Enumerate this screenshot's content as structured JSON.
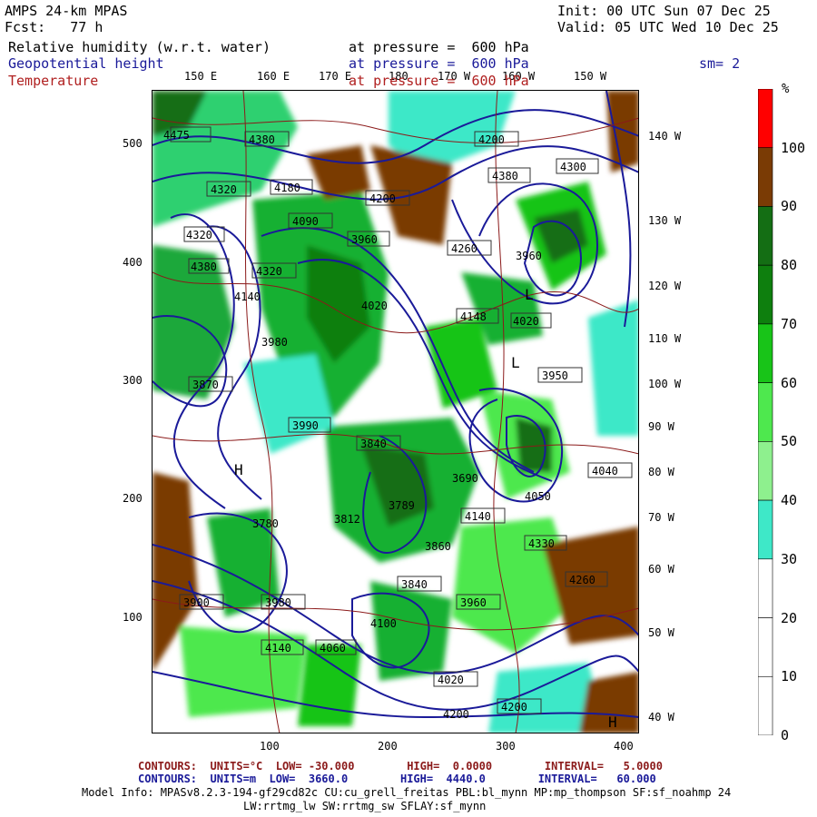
{
  "header": {
    "model_title": "AMPS 24-km MPAS",
    "init_label": "Init: 00 UTC Sun 07 Dec 25",
    "fcst_label": "Fcst:   77 h",
    "valid_label": "Valid: 05 UTC Wed 10 Dec 25"
  },
  "fields": [
    {
      "name": "Relative humidity (w.r.t. water)",
      "level": "at pressure =  600 hPa",
      "color": "#000000"
    },
    {
      "name": "Geopotential height",
      "level": "at pressure =  600 hPa",
      "color": "#1a1a99"
    },
    {
      "name": "Temperature",
      "level": "at pressure =  600 hPa",
      "color": "#b02020"
    }
  ],
  "smoothing": "sm= 2",
  "map": {
    "top_lon_labels": [
      "150 E",
      "160 E",
      "170 E",
      "180",
      "170 W",
      "160 W",
      "150 W"
    ],
    "right_lon_labels": [
      "140 W",
      "130 W",
      "120 W",
      "110 W",
      "100 W",
      "90 W",
      "80 W",
      "70 W",
      "60 W",
      "50 W",
      "40 W"
    ],
    "y_ticks": [
      "500",
      "400",
      "300",
      "200",
      "100"
    ],
    "x_ticks": [
      "100",
      "200",
      "300",
      "400"
    ],
    "height_labels": [
      "4475",
      "4380",
      "4320",
      "4320",
      "4200",
      "4380",
      "4300",
      "4200",
      "4180",
      "4090",
      "3960",
      "4380",
      "4320",
      "4260",
      "3980",
      "4140",
      "4148",
      "4020",
      "3960",
      "3870",
      "4020",
      "3950",
      "3990",
      "3840",
      "4050",
      "4140",
      "3780",
      "3812",
      "3789",
      "3860",
      "3690",
      "3840",
      "3960",
      "4100",
      "4060",
      "4140",
      "4020",
      "4200",
      "4200",
      "3900",
      "3980",
      "4260",
      "4040",
      "4330"
    ],
    "high_low_marks": [
      "H",
      "L",
      "L",
      "H"
    ]
  },
  "legend": {
    "unit": "%",
    "levels": [
      "100",
      "90",
      "80",
      "70",
      "60",
      "50",
      "40",
      "30",
      "20",
      "10",
      "0"
    ],
    "colors": [
      "#ff0000",
      "#7a3b05",
      "#146e14",
      "#0e7f0e",
      "#18c418",
      "#4ee84e",
      "#8ef08e",
      "#3ee8c8",
      "#ffffff",
      "#ffffff",
      "#ffffff"
    ]
  },
  "footer": {
    "temp_contours": "CONTOURS:  UNITS=°C  LOW= -30.000        HIGH=  0.0000        INTERVAL=   5.0000",
    "height_contours": "CONTOURS:  UNITS=m  LOW=  3660.0        HIGH=  4440.0        INTERVAL=   60.000",
    "model_info_1": "Model Info: MPASv8.2.3-194-gf29cd82c CU:cu_grell_freitas PBL:bl_mynn MP:mp_thompson SF:sf_noahmp 24",
    "model_info_2": "LW:rrtmg_lw SW:rrtmg_sw SFLAY:sf_mynn"
  }
}
